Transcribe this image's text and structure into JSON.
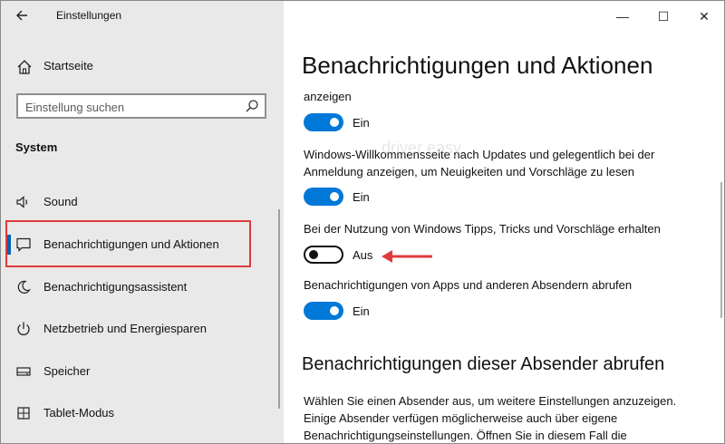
{
  "window": {
    "title": "Einstellungen",
    "controls": {
      "minimize": "—",
      "maximize": "☐",
      "close": "✕"
    }
  },
  "sidebar": {
    "home_label": "Startseite",
    "search_placeholder": "Einstellung suchen",
    "section_title": "System",
    "items": [
      {
        "label": "Sound",
        "icon": "speaker-icon"
      },
      {
        "label": "Benachrichtigungen und Aktionen",
        "icon": "notification-icon",
        "selected": true
      },
      {
        "label": "Benachrichtigungsassistent",
        "icon": "moon-icon"
      },
      {
        "label": "Netzbetrieb und Energiesparen",
        "icon": "power-icon"
      },
      {
        "label": "Speicher",
        "icon": "storage-icon"
      },
      {
        "label": "Tablet-Modus",
        "icon": "tablet-icon"
      }
    ]
  },
  "main": {
    "title": "Benachrichtigungen und Aktionen",
    "settings": [
      {
        "text_partial": "anzeigen",
        "state": "Ein",
        "on": true
      },
      {
        "text": "Windows-Willkommensseite nach Updates und gelegentlich bei der Anmeldung anzeigen, um Neuigkeiten und Vorschläge zu lesen",
        "state": "Ein",
        "on": true
      },
      {
        "text": "Bei der Nutzung von Windows Tipps, Tricks und Vorschläge erhalten",
        "state": "Aus",
        "on": false
      },
      {
        "text": "Benachrichtigungen von Apps und anderen Absendern abrufen",
        "state": "Ein",
        "on": true
      }
    ],
    "subheading": "Benachrichtigungen dieser Absender abrufen",
    "description": "Wählen Sie einen Absender aus, um weitere Einstellungen anzuzeigen. Einige Absender verfügen möglicherweise auch über eigene Benachrichtigungseinstellungen. Öffnen Sie in diesem Fall die"
  },
  "watermark": "driver easy",
  "colors": {
    "accent": "#0078d7",
    "highlight": "#e03b3b",
    "sidebar_bg": "#e9e9e9"
  }
}
